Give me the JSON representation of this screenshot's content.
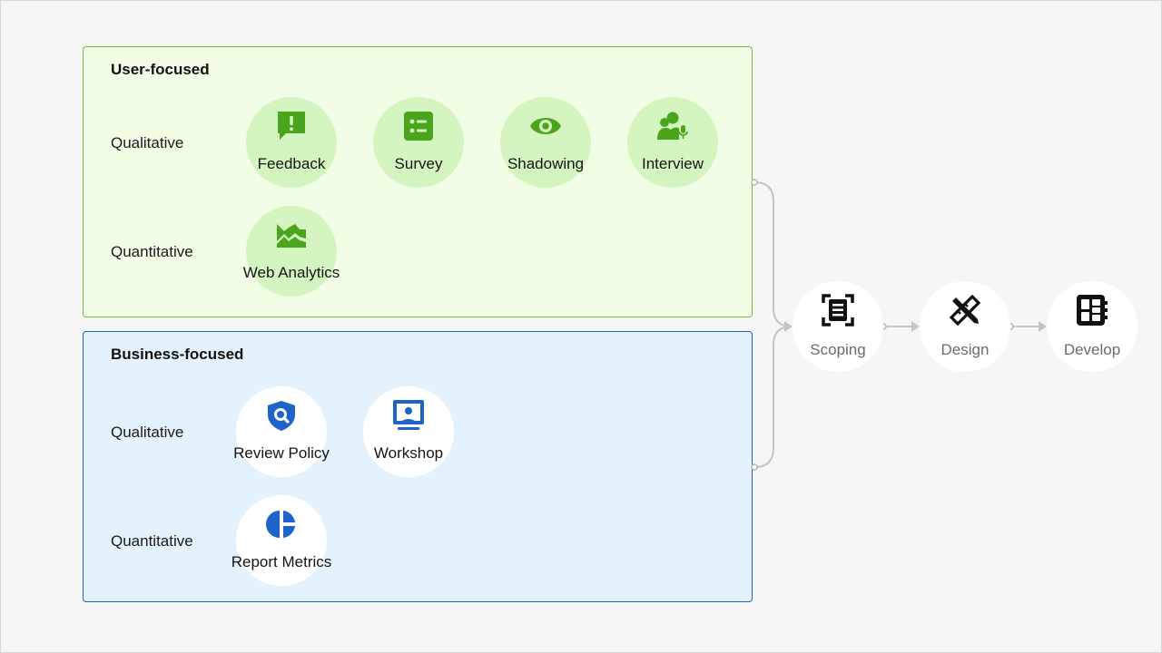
{
  "user_group": {
    "title": "User-focused",
    "rows": [
      {
        "label": "Qualitative",
        "items": [
          {
            "label": "Feedback",
            "icon": "feedback-icon"
          },
          {
            "label": "Survey",
            "icon": "survey-icon"
          },
          {
            "label": "Shadowing",
            "icon": "eye-icon"
          },
          {
            "label": "Interview",
            "icon": "interview-icon"
          }
        ]
      },
      {
        "label": "Quantitative",
        "items": [
          {
            "label": "Web Analytics",
            "icon": "analytics-chart-icon"
          }
        ]
      }
    ],
    "accent": "#4aa51d",
    "background": "#f2fde6"
  },
  "business_group": {
    "title": "Business-focused",
    "rows": [
      {
        "label": "Qualitative",
        "items": [
          {
            "label": "Review Policy",
            "icon": "shield-search-icon"
          },
          {
            "label": "Workshop",
            "icon": "presentation-icon"
          }
        ]
      },
      {
        "label": "Quantitative",
        "items": [
          {
            "label": "Report Metrics",
            "icon": "pie-chart-icon"
          }
        ]
      }
    ],
    "accent": "#1d63c8",
    "background": "#e4f2fd"
  },
  "stages": [
    {
      "label": "Scoping",
      "icon": "scoping-icon"
    },
    {
      "label": "Design",
      "icon": "design-tools-icon"
    },
    {
      "label": "Develop",
      "icon": "develop-icon"
    }
  ]
}
